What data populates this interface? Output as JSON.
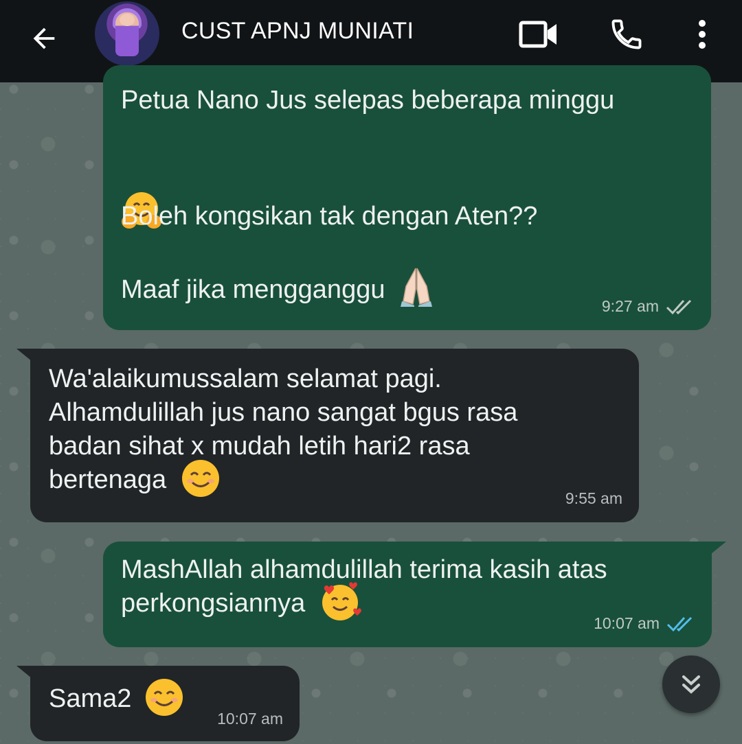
{
  "header": {
    "title": "CUST APNJ MUNIATI",
    "icons": [
      "back-arrow-icon",
      "video-call-icon",
      "phone-call-icon",
      "more-options-icon"
    ]
  },
  "messages": [
    {
      "direction": "outgoing",
      "lines_visible": "Petua Nano Jus selepas beberapa minggu",
      "emoji_1": "hugging-face-emoji",
      "line_2": "Boleh kongsikan tak dengan Aten??",
      "line_3": "Maaf jika mengganggu",
      "emoji_2": "folded-hands-emoji",
      "time": "9:27 am",
      "status": "read"
    },
    {
      "direction": "incoming",
      "text": "Wa'alaikumussalam selamat pagi.\nAlhamdulillah jus nano sangat bgus rasa\nbadan sihat x mudah letih hari2 rasa\nbertenaga",
      "emoji": "smiling-face-emoji",
      "time": "9:55 am"
    },
    {
      "direction": "outgoing",
      "text": "MashAllah alhamdulillah terima kasih atas\nperkongsiannya",
      "emoji": "smiling-face-with-hearts-emoji",
      "time": "10:07 am",
      "status": "read"
    },
    {
      "direction": "incoming",
      "text": "Sama2",
      "emoji": "smiling-face-emoji",
      "time": "10:07 am"
    }
  ],
  "colors": {
    "header_bg": "#111416",
    "outgoing_bubble": "#19503b",
    "incoming_bubble": "#212528",
    "read_tick_blue": "#53bdeb",
    "wallpaper": "#5b6a66"
  }
}
